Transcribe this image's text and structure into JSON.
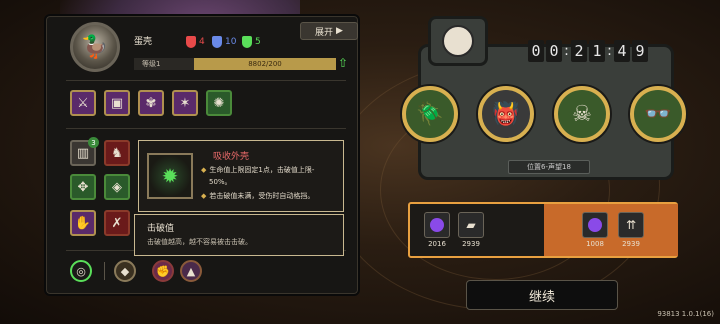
{
  "player": {
    "name": "蛋壳",
    "level_label": "等级1",
    "xp_text": "8802/200"
  },
  "resources": [
    {
      "icon": "red-mask-icon",
      "value": "4",
      "color": "#e84a4a"
    },
    {
      "icon": "blue-mask-icon",
      "value": "10",
      "color": "#6a8ae8"
    },
    {
      "icon": "green-mask-icon",
      "value": "5",
      "color": "#5adf5a"
    }
  ],
  "expand_button": {
    "label": "展开",
    "icon": "play-icon"
  },
  "skills_top": [
    "sword-icon",
    "chest-icon",
    "tentacle-icon",
    "spider-icon",
    "bug-icon"
  ],
  "skills_grid_badge": "3",
  "tooltip": {
    "title": "吸收外壳",
    "lines": [
      "生命值上限固定1点，击破值上限-",
      "50%。",
      "若击破值未满，受伤时自动格挡。"
    ]
  },
  "tooltip2": {
    "title": "击破值",
    "desc": "击破值越高，越不容易被击击破。"
  },
  "timer": [
    "0",
    "0",
    ":",
    "2",
    "1",
    ":",
    "4",
    "9"
  ],
  "position_label": "位置6-声望18",
  "bosses": [
    "beetle-icon",
    "demon-icon",
    "hooded-icon",
    "glasses-icon"
  ],
  "choices": {
    "left": [
      {
        "icon": "purple-orb-icon",
        "value": "2016"
      },
      {
        "icon": "card-icon",
        "value": "2939"
      }
    ],
    "right": [
      {
        "icon": "purple-orb-icon",
        "value": "1008"
      },
      {
        "icon": "card-up-icon",
        "value": "2939"
      }
    ]
  },
  "continue_label": "继续",
  "version": "93813 1.0.1(16)",
  "colors": {
    "accent": "#e8a040",
    "selected": "#c86a2a",
    "xp": "#b89a4a"
  }
}
